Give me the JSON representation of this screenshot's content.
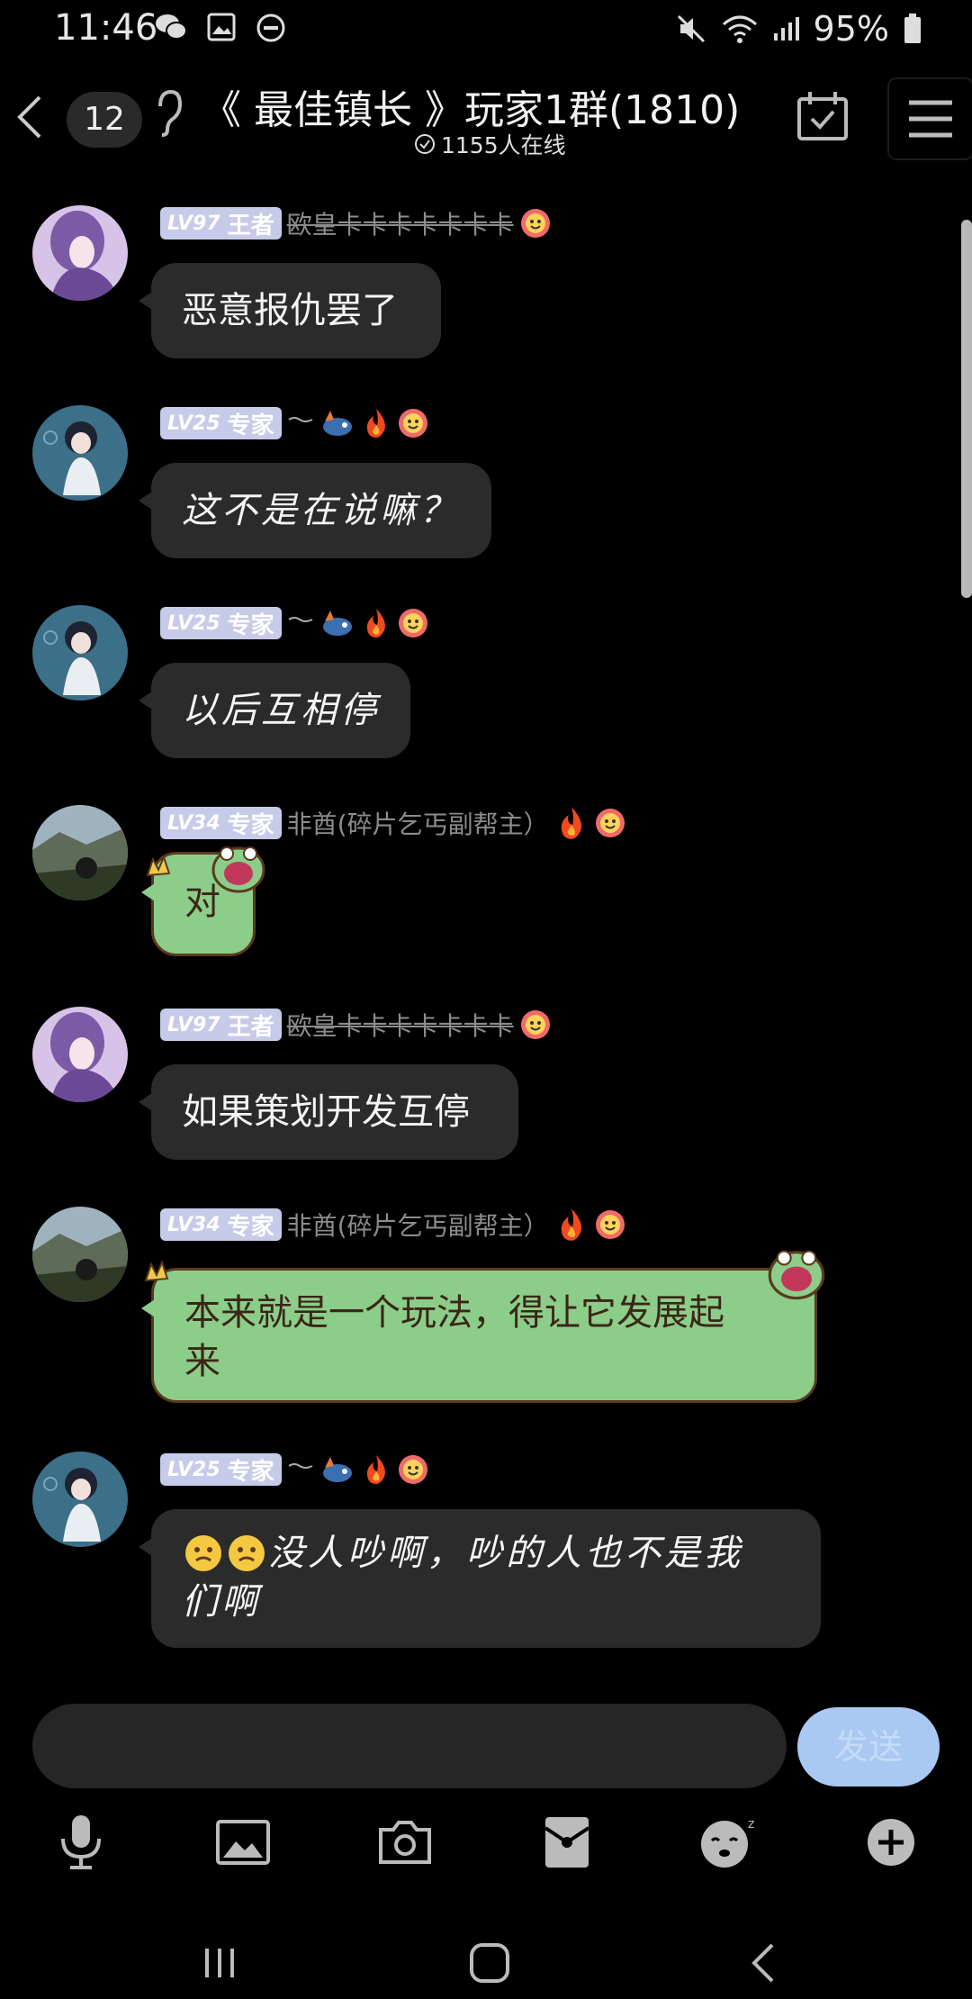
{
  "status_bar": {
    "time": "11:46",
    "battery": "95%",
    "icons": [
      "wechat-icon",
      "image-icon",
      "dnd-icon",
      "mute-icon",
      "wifi-icon",
      "signal-icon",
      "battery-icon"
    ]
  },
  "header": {
    "unread_count": "12",
    "title": "《 最佳镇长 》玩家1群(1810)",
    "online": "1155人在线"
  },
  "messages": [
    {
      "level": "LV97",
      "rank": "王者",
      "name": "欧皇卡卡卡卡卡卡卡",
      "text": "恶意报仇罢了"
    },
    {
      "level": "LV25",
      "rank": "专家",
      "name": "",
      "text": "这不是在说嘛？"
    },
    {
      "level": "LV25",
      "rank": "专家",
      "name": "",
      "text": "以后互相停"
    },
    {
      "level": "LV34",
      "rank": "专家",
      "name": "非酋(碎片乞丐副帮主）",
      "text": "对"
    },
    {
      "level": "LV97",
      "rank": "王者",
      "name": "欧皇卡卡卡卡卡卡卡",
      "text": "如果策划开发互停"
    },
    {
      "level": "LV34",
      "rank": "专家",
      "name": "非酋(碎片乞丐副帮主）",
      "text_line1": "本来就是一个玩法，得让它发展起",
      "text_line2": "来"
    },
    {
      "level": "LV25",
      "rank": "专家",
      "name": "",
      "text_line1": "没人吵啊，吵的人也不是我",
      "text_line2": "们啊"
    }
  ],
  "input": {
    "placeholder": "",
    "send_label": "发送"
  },
  "toolbar": [
    "microphone-icon",
    "image-icon",
    "camera-icon",
    "red-packet-icon",
    "emoji-icon",
    "plus-icon"
  ],
  "colors": {
    "background": "#000000",
    "bubble": "#2b2b2b",
    "bubble_green": "#8ccd8a",
    "level_badge": "#c5cbe8",
    "send_button": "#a9c9f2"
  }
}
